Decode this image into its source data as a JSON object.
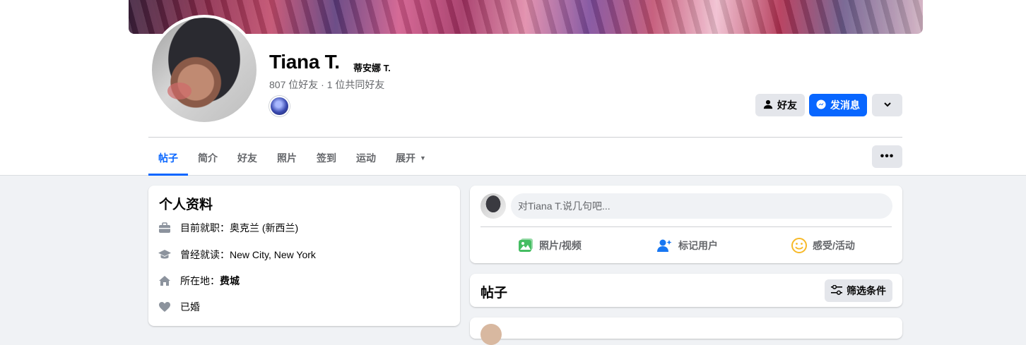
{
  "profile": {
    "name": "Tiana T.",
    "alt_name": "蒂安娜 T.",
    "friends_count": "807 位好友 · 1 位共同好友"
  },
  "actions": {
    "friend_label": "好友",
    "message_label": "发消息"
  },
  "tabs": [
    {
      "label": "帖子"
    },
    {
      "label": "简介"
    },
    {
      "label": "好友"
    },
    {
      "label": "照片"
    },
    {
      "label": "签到"
    },
    {
      "label": "运动"
    },
    {
      "label": "展开"
    }
  ],
  "intro": {
    "title": "个人资料",
    "work_prefix": "目前就职：",
    "work_value": "奥克兰 (新西兰)",
    "study_prefix": "曾经就读：",
    "study_value": "New City, New York",
    "lives_prefix": "所在地：",
    "lives_value": "费城",
    "relationship": "已婚"
  },
  "composer": {
    "placeholder": "对Tiana T.说几句吧...",
    "photo_label": "照片/视频",
    "tag_label": "标记用户",
    "feeling_label": "感受/活动"
  },
  "posts": {
    "title": "帖子",
    "filter_label": "筛选条件"
  },
  "colors": {
    "accent": "#0866ff",
    "photo_icon": "#45bd62",
    "tag_icon": "#1877f2",
    "feeling_icon": "#f7b928"
  }
}
